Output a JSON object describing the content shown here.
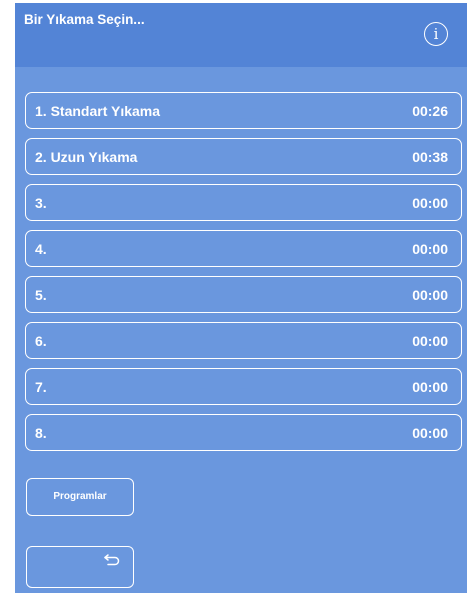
{
  "header": {
    "title": "Bir Yıkama Seçin...",
    "info_glyph": "i"
  },
  "washes": [
    {
      "name": "1. Standart Yıkama",
      "time": "00:26"
    },
    {
      "name": "2. Uzun Yıkama",
      "time": "00:38"
    },
    {
      "name": "3.",
      "time": "00:00"
    },
    {
      "name": "4.",
      "time": "00:00"
    },
    {
      "name": "5.",
      "time": "00:00"
    },
    {
      "name": "6.",
      "time": "00:00"
    },
    {
      "name": "7.",
      "time": "00:00"
    },
    {
      "name": "8.",
      "time": "00:00"
    }
  ],
  "buttons": {
    "programs_label": "Programlar",
    "back_icon": "return-arrow-icon"
  },
  "colors": {
    "background": "#6a97de",
    "header": "#5384d6",
    "foreground": "#ffffff"
  }
}
